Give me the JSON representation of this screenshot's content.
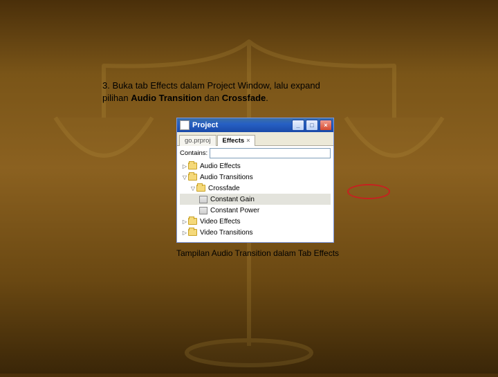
{
  "instruction": {
    "prefix": "3. Buka tab Effects dalam Project Window, lalu expand",
    "line2_a": "pilihan ",
    "bold1": "Audio Transition",
    "mid": " dan ",
    "bold2": "Crossfade",
    "line2_b": "."
  },
  "window": {
    "title": "Project",
    "tabs": [
      {
        "label": "go.prproj",
        "active": false
      },
      {
        "label": "Effects",
        "active": true
      }
    ],
    "containsLabel": "Contains:",
    "containsValue": "",
    "tree": {
      "audioEffects": "Audio Effects",
      "audioTransitions": "Audio Transitions",
      "crossfade": "Crossfade",
      "constantGain": "Constant Gain",
      "constantPower": "Constant Power",
      "videoEffects": "Video Effects",
      "videoTransitions": "Video Transitions"
    }
  },
  "caption": "Tampilan Audio Transition dalam Tab Effects"
}
